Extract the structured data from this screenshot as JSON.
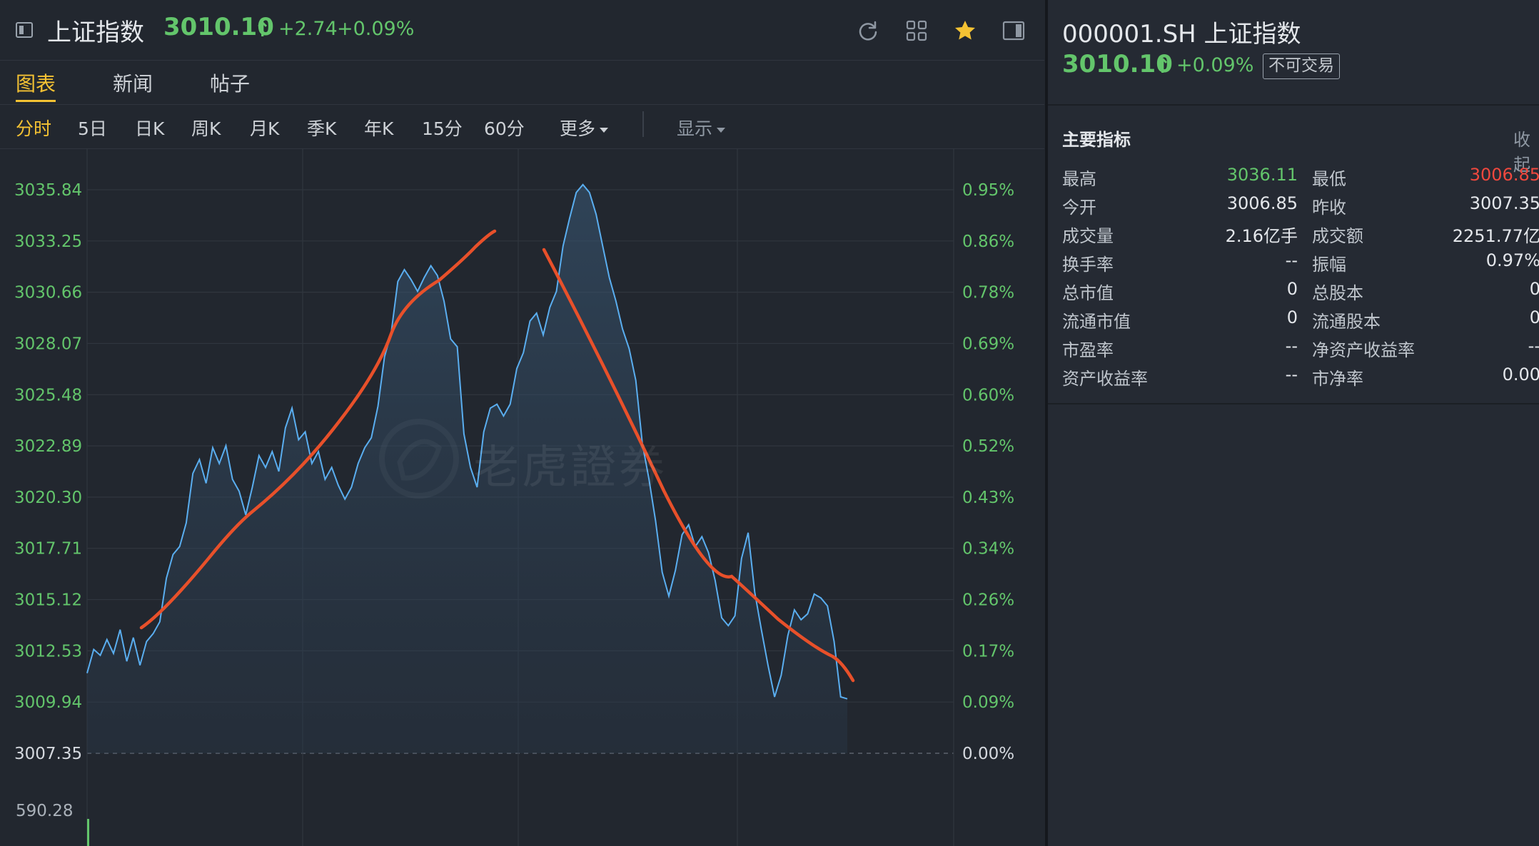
{
  "header": {
    "name": "上证指数",
    "price": "3010.10",
    "arrow": "↑",
    "change": "+2.74",
    "change_pct": "+0.09%"
  },
  "tabs": [
    {
      "label": "图表",
      "active": true
    },
    {
      "label": "新闻",
      "active": false
    },
    {
      "label": "帖子",
      "active": false
    }
  ],
  "periods": [
    "分时",
    "5日",
    "日K",
    "周K",
    "月K",
    "季K",
    "年K",
    "15分",
    "60分"
  ],
  "more_label": "更多",
  "display_label": "显示",
  "watermark": "老虎證券",
  "colors": {
    "up": "#63c56b",
    "down": "#f0483e",
    "accent": "#f4c233",
    "line": "#5aaef0",
    "annotation": "#e8502a"
  },
  "icons": [
    "sidebar-toggle-icon",
    "refresh-icon",
    "grid-icon",
    "star-icon",
    "panel-toggle-icon"
  ],
  "chart_data": {
    "type": "line",
    "y_left_ticks": [
      "3035.84",
      "3033.25",
      "3030.66",
      "3028.07",
      "3025.48",
      "3022.89",
      "3020.30",
      "3017.71",
      "3015.12",
      "3012.53",
      "3009.94",
      "3007.35"
    ],
    "y_right_ticks": [
      "0.95%",
      "0.86%",
      "0.78%",
      "0.69%",
      "0.60%",
      "0.52%",
      "0.43%",
      "0.34%",
      "0.26%",
      "0.17%",
      "0.09%",
      "0.00%"
    ],
    "baseline": 3007.35,
    "ylim": [
      3007.35,
      3035.84
    ],
    "volume_label": "590.28",
    "values": [
      3011.4,
      3012.6,
      3012.3,
      3013.1,
      3012.4,
      3013.6,
      3012.0,
      3013.2,
      3011.8,
      3013.0,
      3013.4,
      3014.0,
      3016.2,
      3017.4,
      3017.8,
      3019.0,
      3021.5,
      3022.2,
      3021.0,
      3022.8,
      3022.0,
      3022.9,
      3021.2,
      3020.6,
      3019.4,
      3020.8,
      3022.4,
      3021.8,
      3022.6,
      3021.6,
      3023.8,
      3024.8,
      3023.2,
      3023.6,
      3022.0,
      3022.6,
      3021.2,
      3021.8,
      3020.9,
      3020.2,
      3020.8,
      3022.0,
      3022.8,
      3023.3,
      3024.9,
      3027.4,
      3028.6,
      3031.2,
      3031.8,
      3031.3,
      3030.7,
      3031.4,
      3032.0,
      3031.5,
      3030.2,
      3028.3,
      3027.9,
      3023.5,
      3021.8,
      3020.8,
      3023.6,
      3024.8,
      3025.0,
      3024.4,
      3025.0,
      3026.8,
      3027.6,
      3029.2,
      3029.6,
      3028.5,
      3029.9,
      3030.7,
      3033.0,
      3034.4,
      3035.7,
      3036.1,
      3035.7,
      3034.6,
      3033.0,
      3031.4,
      3030.2,
      3028.8,
      3027.8,
      3026.2,
      3023.0,
      3021.2,
      3019.1,
      3016.5,
      3015.3,
      3016.6,
      3018.4,
      3018.9,
      3017.8,
      3018.3,
      3017.5,
      3016.1,
      3014.2,
      3013.8,
      3014.3,
      3017.2,
      3018.5,
      3015.5,
      3013.6,
      3011.8,
      3010.2,
      3011.3,
      3013.3,
      3014.6,
      3014.1,
      3014.4,
      3015.4,
      3015.2,
      3014.8,
      3013.0,
      3010.2,
      3010.1
    ]
  },
  "annotation": "hand-drawn red trend curves",
  "right": {
    "code_name": "000001.SH 上证指数",
    "price": "3010.10",
    "arrow": "↑",
    "change_pct": "+0.09%",
    "badge": "不可交易",
    "section_title": "主要指标",
    "collapse": "收起",
    "rows": [
      {
        "l1": "最高",
        "v1": "3036.11",
        "l2": "最低",
        "v2": "3006.85"
      },
      {
        "l1": "今开",
        "v1": "3006.85",
        "l2": "昨收",
        "v2": "3007.35"
      },
      {
        "l1": "成交量",
        "v1": "2.16亿手",
        "l2": "成交额",
        "v2": "2251.77亿"
      },
      {
        "l1": "换手率",
        "v1": "--",
        "l2": "振幅",
        "v2": "0.97%"
      },
      {
        "l1": "总市值",
        "v1": "0",
        "l2": "总股本",
        "v2": "0"
      },
      {
        "l1": "流通市值",
        "v1": "0",
        "l2": "流通股本",
        "v2": "0"
      },
      {
        "l1": "市盈率",
        "v1": "--",
        "l2": "净资产收益率",
        "v2": "--"
      },
      {
        "l1": "资产收益率",
        "v1": "--",
        "l2": "市净率",
        "v2": "0.00"
      }
    ]
  }
}
